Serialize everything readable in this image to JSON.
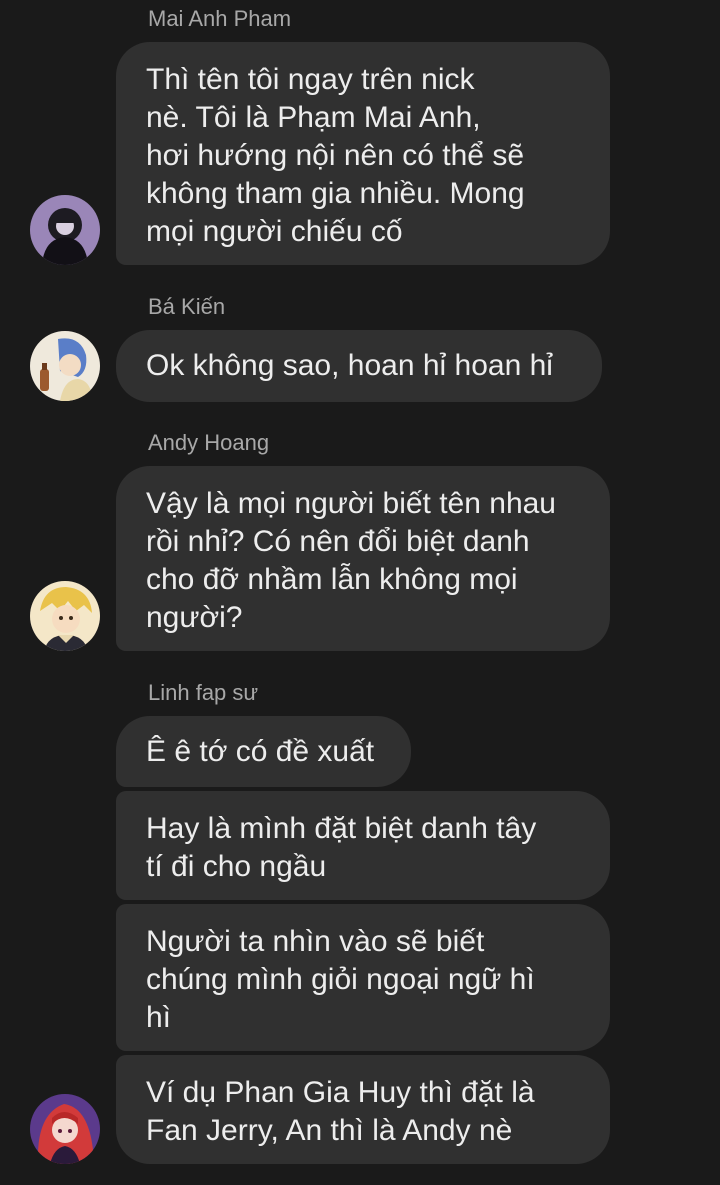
{
  "messages": [
    {
      "sender": "Mai Anh Pham",
      "avatar_icon": "user-avatar-dark-hood",
      "bubbles": [
        "Thì tên tôi ngay trên nick\nnè. Tôi là Phạm Mai Anh,\nhơi hướng nội nên có thể sẽ\nkhông tham gia nhiều. Mong\nmọi người chiếu cố"
      ]
    },
    {
      "sender": "Bá Kiến",
      "avatar_icon": "user-avatar-blue-hair",
      "bubbles": [
        "Ok không sao, hoan hỉ hoan hỉ"
      ]
    },
    {
      "sender": "Andy Hoang",
      "avatar_icon": "user-avatar-blonde",
      "bubbles": [
        "Vậy là mọi người biết tên nhau\nrồi nhỉ? Có nên đổi biệt danh\ncho đỡ nhầm lẫn không mọi\nngười?"
      ]
    },
    {
      "sender": "Linh fap sư",
      "avatar_icon": "user-avatar-red-hair",
      "bubbles": [
        "Ê ê tớ có đề xuất",
        "Hay là mình đặt biệt danh tây\ntí đi cho ngầu",
        "Người ta nhìn vào sẽ biết\nchúng mình giỏi ngoại ngữ hì\nhì",
        "Ví dụ Phan Gia Huy thì đặt là\nFan Jerry, An thì là Andy nè"
      ]
    }
  ],
  "colors": {
    "background": "#1a1a1a",
    "bubble": "#303030",
    "text": "#ededed",
    "sender_text": "#a8a8a8"
  }
}
